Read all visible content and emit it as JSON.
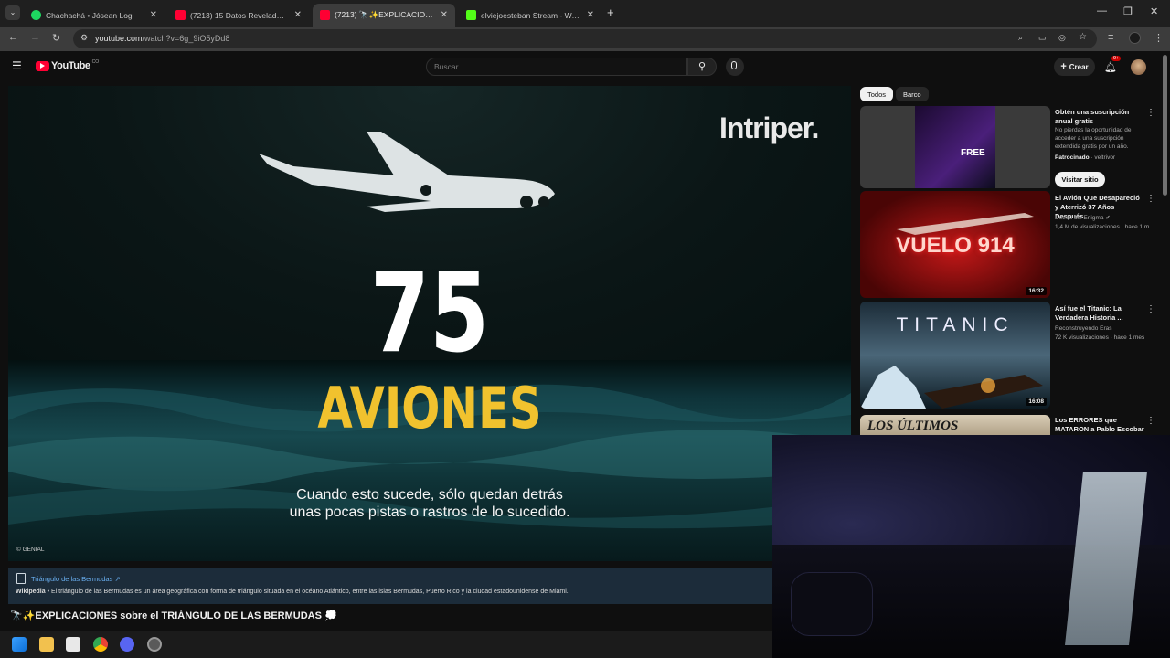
{
  "browser": {
    "tabs": [
      {
        "title": "Chachachá • Jósean Log",
        "favicon_color": "#1ed760",
        "active": false
      },
      {
        "title": "(7213) 15 Datos Reveladores So",
        "favicon_color": "#ff0033",
        "active": false
      },
      {
        "title": "(7213) 🔭✨EXPLICACIONES so",
        "favicon_color": "#ff0033",
        "active": true
      },
      {
        "title": "elviejoesteban Stream - Watch",
        "favicon_color": "#53fc18",
        "active": false
      }
    ],
    "url_host": "youtube.com",
    "url_path": "/watch?v=6g_9iO5yDd8"
  },
  "youtube": {
    "logo": "YouTube",
    "country_code": "CO",
    "search_placeholder": "Buscar",
    "create_label": "Crear",
    "notification_count": "9+",
    "video": {
      "brand": "Intriper.",
      "big_number": "75",
      "big_word": "AVIONES",
      "subtitle_line1": "Cuando esto sucede, sólo quedan detrás",
      "subtitle_line2": "unas pocas pistas o rastros de lo sucedido.",
      "credit": "© GENIAL"
    },
    "info_panel": {
      "title": "Triángulo de las Bermudas",
      "source": "Wikipedia",
      "description": " • El triángulo de las Bermudas es un área geográfica con forma de triángulo situada en el océano Atlántico, entre las islas Bermudas, Puerto Rico y la ciudad estadounidense de Miami."
    },
    "video_title": "🔭✨EXPLICACIONES sobre el TRIÁNGULO DE LAS BERMUDAS 💭",
    "chips": [
      "Todos",
      "Barco"
    ],
    "ad": {
      "title": "Obtén una suscripción anual gratis",
      "description": "No pierdas la oportunidad de acceder a una suscripción extendida gratis por un año.",
      "sponsored": "Patrocinado",
      "advertiser": " · veltrivor",
      "cta": "Visitar sitio",
      "thumb_text": "FREE"
    },
    "recommendations": [
      {
        "title": "El Avión Que Desapareció y Aterrizó 37 Años Después ...",
        "channel": "Detrás del Enigma",
        "meta": "1,4 M de visualizaciones · hace 1 m...",
        "duration": "16:32",
        "thumb_text": "VUELO 914"
      },
      {
        "title": "Así fue el Titanic: La Verdadera Historia ...",
        "channel": "Reconstruyendo Eras",
        "meta": "72 K visualizaciones · hace 1 mes",
        "duration": "16:08",
        "thumb_text": "TITANIC"
      },
      {
        "title": "Los ERRORES que MATARON a Pablo Escobar",
        "channel": "",
        "meta": "",
        "duration": "",
        "thumb_text": "LOS ÚLTIMOS"
      }
    ]
  }
}
